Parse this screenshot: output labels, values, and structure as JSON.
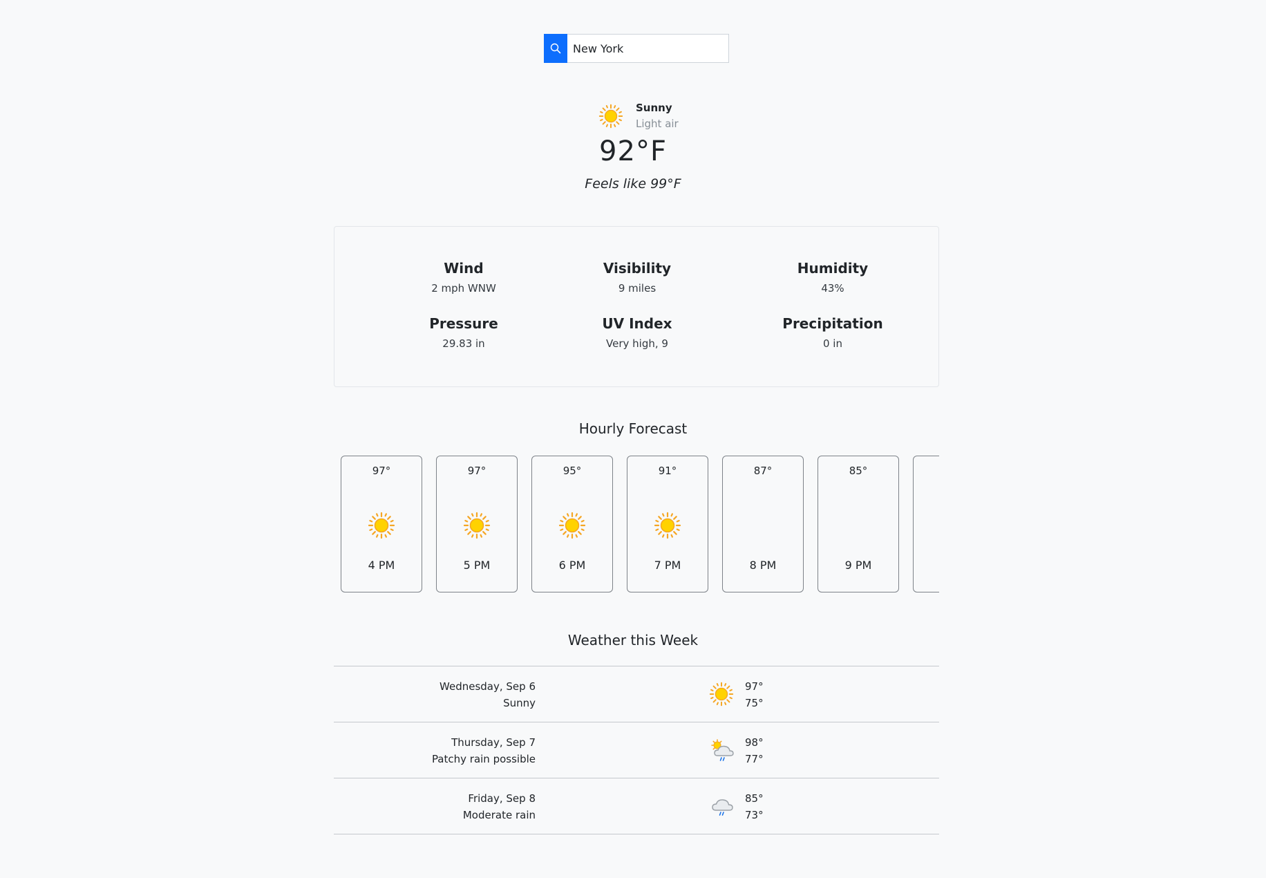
{
  "search": {
    "value": "New York",
    "icon": "search-icon"
  },
  "current": {
    "condition": "Sunny",
    "description": "Light air",
    "temperature": "92°F",
    "feels_like": "Feels like 99°F",
    "icon": "sun-icon"
  },
  "details": [
    {
      "label": "Wind",
      "value": "2 mph WNW"
    },
    {
      "label": "Visibility",
      "value": "9 miles"
    },
    {
      "label": "Humidity",
      "value": "43%"
    },
    {
      "label": "Pressure",
      "value": "29.83 in"
    },
    {
      "label": "UV Index",
      "value": "Very high, 9"
    },
    {
      "label": "Precipitation",
      "value": "0 in"
    }
  ],
  "hourly": {
    "title": "Hourly Forecast",
    "items": [
      {
        "temp": "97°",
        "time": "4 PM",
        "icon": "sun-icon"
      },
      {
        "temp": "97°",
        "time": "5 PM",
        "icon": "sun-icon"
      },
      {
        "temp": "95°",
        "time": "6 PM",
        "icon": "sun-icon"
      },
      {
        "temp": "91°",
        "time": "7 PM",
        "icon": "sun-icon"
      },
      {
        "temp": "87°",
        "time": "8 PM",
        "icon": "moon-icon"
      },
      {
        "temp": "85°",
        "time": "9 PM",
        "icon": "moon-icon"
      }
    ]
  },
  "weekly": {
    "title": "Weather this Week",
    "days": [
      {
        "date": "Wednesday, Sep 6",
        "condition": "Sunny",
        "high": "97°",
        "low": "75°",
        "icon": "sun-icon"
      },
      {
        "date": "Thursday, Sep 7",
        "condition": "Patchy rain possible",
        "high": "98°",
        "low": "77°",
        "icon": "partly-cloudy-rain-icon"
      },
      {
        "date": "Friday, Sep 8",
        "condition": "Moderate rain",
        "high": "85°",
        "low": "73°",
        "icon": "cloud-rain-icon"
      }
    ]
  },
  "colors": {
    "accent": "#0d6efd",
    "sun": "#ffcc00",
    "sun_ray": "#f5a623",
    "moon": "#1a73e8"
  }
}
